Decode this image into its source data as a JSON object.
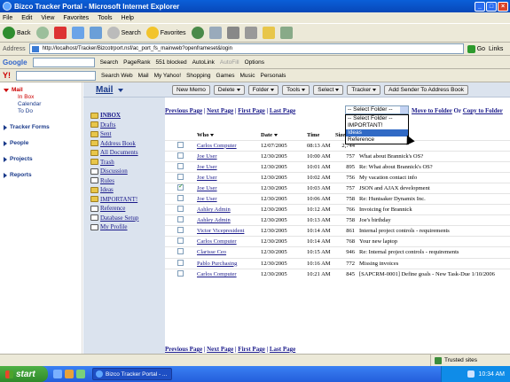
{
  "window": {
    "title": "Bizco Tracker Portal - Microsoft Internet Explorer"
  },
  "menu": [
    "File",
    "Edit",
    "View",
    "Favorites",
    "Tools",
    "Help"
  ],
  "toolbar": {
    "back": "Back",
    "search": "Search",
    "favorites": "Favorites"
  },
  "address": {
    "label": "Address",
    "url": "http://localhost/Tracker/Bizcotrport.nsf/ac_port_fs_mainweb?openframeset&login",
    "go": "Go",
    "links": "Links"
  },
  "google": {
    "logo": "Google",
    "search": "Search",
    "pagerank": "PageRank",
    "blocked": "551 blocked",
    "autolink": "AutoLink",
    "autofill": "AutoFill",
    "options": "Options"
  },
  "yahoo": {
    "logo": "Y!",
    "search_web": "Search Web",
    "mail": "Mail",
    "my_yahoo": "My Yahoo!",
    "shopping": "Shopping",
    "games": "Games",
    "music": "Music",
    "personals": "Personals"
  },
  "leftnav": {
    "mail": "Mail",
    "in_box": "In Box",
    "calendar": "Calendar",
    "todo": "To Do",
    "tracker_forms": "Tracker Forms",
    "people": "People",
    "projects": "Projects",
    "reports": "Reports"
  },
  "section": {
    "title": "Mail"
  },
  "actions": {
    "new_memo": "New Memo",
    "delete": "Delete",
    "folder": "Folder",
    "tools": "Tools",
    "select": "Select",
    "tracker": "Tracker",
    "add_sender": "Add Sender To Address Book"
  },
  "folders": [
    "INBOX",
    "Drafts",
    "Sent",
    "Address Book",
    "All Documents",
    "Trash",
    "Discussion",
    "Rules",
    "Ideas",
    "IMPORTANT!",
    "Reference",
    "Database Setup",
    "My Profile"
  ],
  "pager": {
    "previous": "Previous Page",
    "next": "Next Page",
    "first": "First Page",
    "last": "Last Page"
  },
  "folder_select": {
    "value": "-- Select Folder --",
    "options": [
      "-- Select Folder --",
      "IMPORTANT!",
      "Ideas",
      "Reference"
    ]
  },
  "move": {
    "move_to_folder": "Move to Folder",
    "or": "Or",
    "copy_to_folder": "Copy to Folder"
  },
  "columns": {
    "who": "Who",
    "date": "Date",
    "time": "Time",
    "size": "Size"
  },
  "messages": [
    {
      "who": "Carlos Computer",
      "date": "12/07/2005",
      "time": "08:13 AM",
      "size": "2,744",
      "subject": "",
      "checked": false
    },
    {
      "who": "Joe User",
      "date": "12/30/2005",
      "time": "10:00 AM",
      "size": "757",
      "subject": "What about Brannick's OS?",
      "checked": false
    },
    {
      "who": "Joe User",
      "date": "12/30/2005",
      "time": "10:01 AM",
      "size": "895",
      "subject": "Re: What about Brannick's OS?",
      "checked": false
    },
    {
      "who": "Joe User",
      "date": "12/30/2005",
      "time": "10:02 AM",
      "size": "756",
      "subject": "My vacation contact info",
      "checked": false
    },
    {
      "who": "Joe User",
      "date": "12/30/2005",
      "time": "10:03 AM",
      "size": "757",
      "subject": "JSON and AJAX development",
      "checked": true
    },
    {
      "who": "Joe User",
      "date": "12/30/2005",
      "time": "10:06 AM",
      "size": "758",
      "subject": "Re: Huntsaker Dynamix Inc.",
      "checked": false
    },
    {
      "who": "Ashley Admin",
      "date": "12/30/2005",
      "time": "10:12 AM",
      "size": "766",
      "subject": "Invoicing for Brannick",
      "checked": false
    },
    {
      "who": "Ashley Admin",
      "date": "12/30/2005",
      "time": "10:13 AM",
      "size": "758",
      "subject": "Joe's birthday",
      "checked": false
    },
    {
      "who": "Victor Vicepresident",
      "date": "12/30/2005",
      "time": "10:14 AM",
      "size": "861",
      "subject": "Internal project controls - requirements",
      "checked": false
    },
    {
      "who": "Carlos Computer",
      "date": "12/30/2005",
      "time": "10:14 AM",
      "size": "768",
      "subject": "Your new laptop",
      "checked": false
    },
    {
      "who": "Clarisse Ceo",
      "date": "12/30/2005",
      "time": "10:15 AM",
      "size": "946",
      "subject": "Re: Internal project controls - requirements",
      "checked": false
    },
    {
      "who": "Pablo Purchasing",
      "date": "12/30/2005",
      "time": "10:16 AM",
      "size": "772",
      "subject": "Missing invoices",
      "checked": false
    },
    {
      "who": "Carlos Computer",
      "date": "12/30/2005",
      "time": "10:21 AM",
      "size": "845",
      "subject": "[SAPCRM-0001] Define goals - New Task-Due 1/10/2006",
      "checked": false
    }
  ],
  "status": {
    "left": "",
    "zone": "Trusted sites"
  },
  "taskbar": {
    "start": "start",
    "task": "Bizco Tracker Portal - ...",
    "clock": "10:34 AM"
  }
}
